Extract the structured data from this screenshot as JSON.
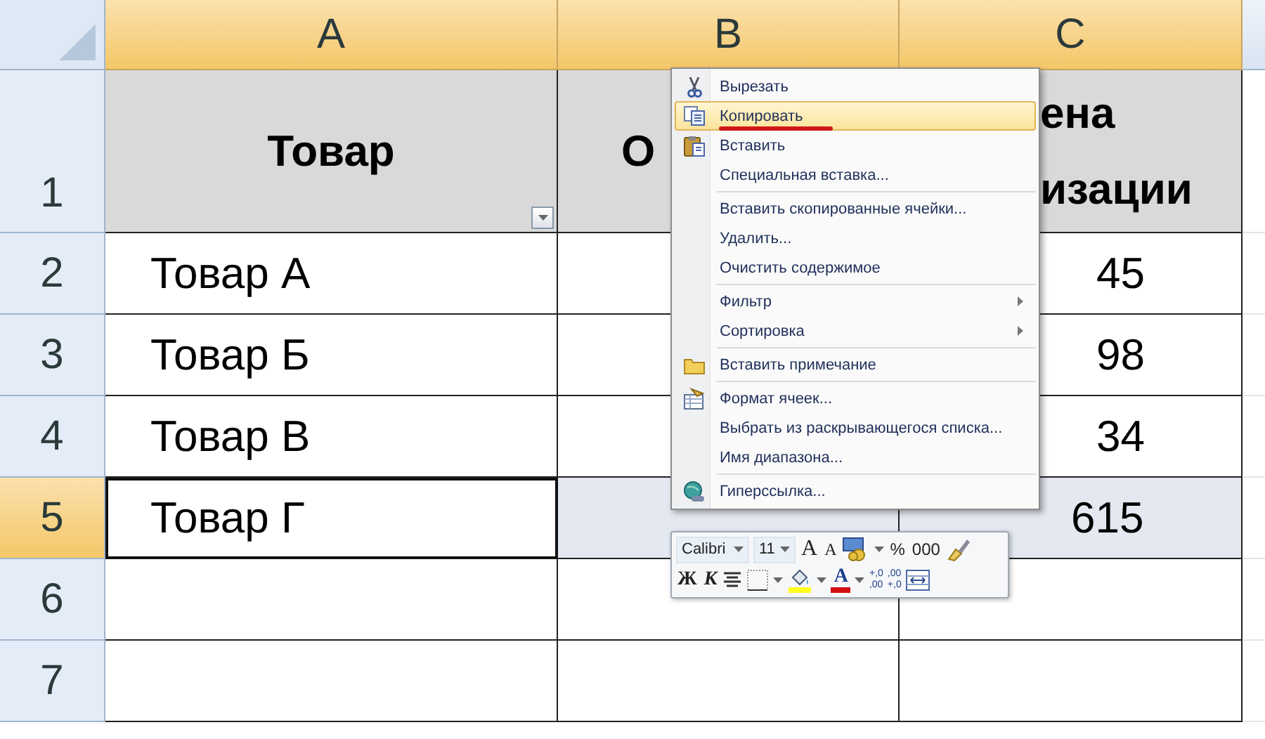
{
  "columns": [
    {
      "label": "A",
      "selected": true
    },
    {
      "label": "B",
      "selected": true
    },
    {
      "label": "C",
      "selected": true
    }
  ],
  "rows": [
    {
      "label": "1",
      "kind": "title",
      "selected": false,
      "cells": [
        {
          "lines": [
            "Товар"
          ],
          "filter": true,
          "active": false
        },
        {
          "lines": [
            "О"
          ],
          "active": false
        },
        {
          "lines": [
            "ена",
            "изации"
          ],
          "active": false
        }
      ]
    },
    {
      "label": "2",
      "kind": "data",
      "selected": false,
      "cells": [
        {
          "lines": [
            "Товар А"
          ],
          "active": false
        },
        {
          "active": false
        },
        {
          "lines": [
            "45"
          ],
          "active": false
        }
      ]
    },
    {
      "label": "3",
      "kind": "data",
      "selected": false,
      "cells": [
        {
          "lines": [
            "Товар Б"
          ],
          "active": false
        },
        {
          "active": false
        },
        {
          "lines": [
            "98"
          ],
          "active": false
        }
      ]
    },
    {
      "label": "4",
      "kind": "data",
      "selected": false,
      "cells": [
        {
          "lines": [
            "Товар В"
          ],
          "active": false
        },
        {
          "active": false
        },
        {
          "lines": [
            "34"
          ],
          "active": false
        }
      ]
    },
    {
      "label": "5",
      "kind": "data",
      "selected": true,
      "cells": [
        {
          "lines": [
            "Товар Г"
          ],
          "active": true
        },
        {
          "active": false
        },
        {
          "lines": [
            "615"
          ],
          "active": false
        }
      ]
    },
    {
      "label": "6",
      "kind": "data",
      "selected": false,
      "cells": [
        {
          "active": false
        },
        {
          "active": false
        },
        {
          "active": false
        }
      ]
    },
    {
      "label": "7",
      "kind": "data",
      "selected": false,
      "cells": [
        {
          "active": false
        },
        {
          "active": false
        },
        {
          "active": false
        }
      ]
    }
  ],
  "context_menu": {
    "groups": [
      [
        {
          "label": "Вырезать",
          "kind": "cut",
          "selected": false,
          "submenu": false
        },
        {
          "label": "Копировать",
          "kind": "copy",
          "selected": true,
          "submenu": false
        },
        {
          "label": "Вставить",
          "kind": "paste",
          "selected": false,
          "submenu": false
        },
        {
          "label": "Специальная вставка...",
          "kind": "plain",
          "selected": false,
          "submenu": false
        }
      ],
      [
        {
          "label": "Вставить скопированные ячейки...",
          "kind": "plain",
          "selected": false,
          "submenu": false
        },
        {
          "label": "Удалить...",
          "kind": "plain",
          "selected": false,
          "submenu": false
        },
        {
          "label": "Очистить содержимое",
          "kind": "plain",
          "selected": false,
          "submenu": false
        }
      ],
      [
        {
          "label": "Фильтр",
          "kind": "plain",
          "selected": false,
          "submenu": true
        },
        {
          "label": "Сортировка",
          "kind": "plain",
          "selected": false,
          "submenu": true
        }
      ],
      [
        {
          "label": "Вставить примечание",
          "kind": "comment",
          "selected": false,
          "submenu": false
        }
      ],
      [
        {
          "label": "Формат ячеек...",
          "kind": "format",
          "selected": false,
          "submenu": false
        },
        {
          "label": "Выбрать из раскрывающегося списка...",
          "kind": "plain",
          "selected": false,
          "submenu": false
        },
        {
          "label": "Имя диапазона...",
          "kind": "plain",
          "selected": false,
          "submenu": false
        }
      ],
      [
        {
          "label": "Гиперссылка...",
          "kind": "link",
          "selected": false,
          "submenu": false
        }
      ]
    ]
  },
  "mini_toolbar": {
    "top_row": [
      {
        "kind": "font-field",
        "value": "Calibri"
      },
      {
        "kind": "size-field",
        "value": "11"
      },
      {
        "kind": "grow",
        "text": "A"
      },
      {
        "kind": "shrink",
        "text": "A"
      },
      {
        "kind": "accounting"
      },
      {
        "kind": "caret"
      },
      {
        "kind": "glyph",
        "text": "%"
      },
      {
        "kind": "glyph",
        "text": "000"
      },
      {
        "kind": "painter"
      }
    ],
    "bottom_row": [
      {
        "kind": "bold",
        "text": "Ж"
      },
      {
        "kind": "italic",
        "text": "К"
      },
      {
        "kind": "align"
      },
      {
        "kind": "borders"
      },
      {
        "kind": "caret"
      },
      {
        "kind": "fill"
      },
      {
        "kind": "caret"
      },
      {
        "kind": "font-color",
        "text": "A"
      },
      {
        "kind": "caret"
      },
      {
        "kind": "decimal",
        "lines": [
          "+,0",
          ",00"
        ]
      },
      {
        "kind": "decimal",
        "lines": [
          ",00",
          "+,0"
        ]
      },
      {
        "kind": "merge"
      }
    ]
  }
}
